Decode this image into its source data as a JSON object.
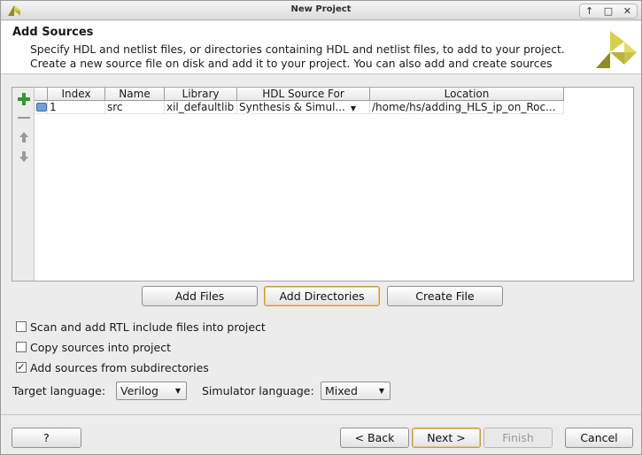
{
  "window": {
    "title": "New Project",
    "controls": [
      "↑",
      "□",
      "✕"
    ]
  },
  "header": {
    "title": "Add Sources",
    "description_line1": "Specify HDL and netlist files, or directories containing HDL and netlist files, to add to your project.",
    "description_line2": "Create a new source file on disk and add it to your project. You can also add and create sources"
  },
  "toolbar": {
    "add_icon": "plus-icon",
    "remove_icon": "minus-icon",
    "up_icon": "arrow-up-icon",
    "down_icon": "arrow-down-icon"
  },
  "table": {
    "columns": [
      "",
      "Index",
      "Name",
      "Library",
      "HDL Source For",
      "Location"
    ],
    "rows": [
      {
        "index": "1",
        "name": "src",
        "library": "xil_defaultlib",
        "hdl_source_for": "Synthesis & Simul...",
        "location": "/home/hs/adding_HLS_ip_on_Roc..."
      }
    ]
  },
  "buttons": {
    "add_files": "Add Files",
    "add_directories": "Add Directories",
    "create_file": "Create File"
  },
  "options": {
    "scan_rtl": {
      "label": "Scan and add RTL include files into project",
      "checked": false
    },
    "copy_sources": {
      "label": "Copy sources into project",
      "checked": false
    },
    "add_subdirs": {
      "label": "Add sources from subdirectories",
      "checked": true
    }
  },
  "target_language": {
    "label": "Target language:",
    "value": "Verilog"
  },
  "simulator_language": {
    "label": "Simulator language:",
    "value": "Mixed"
  },
  "footer": {
    "help": "?",
    "back": "< Back",
    "next": "Next >",
    "finish": "Finish",
    "cancel": "Cancel"
  },
  "colors": {
    "accent_green": "#2e9a2e",
    "focus_border": "#c79b3b",
    "logo_yellow": "#d6d14a",
    "logo_olive": "#8f8b2a"
  }
}
